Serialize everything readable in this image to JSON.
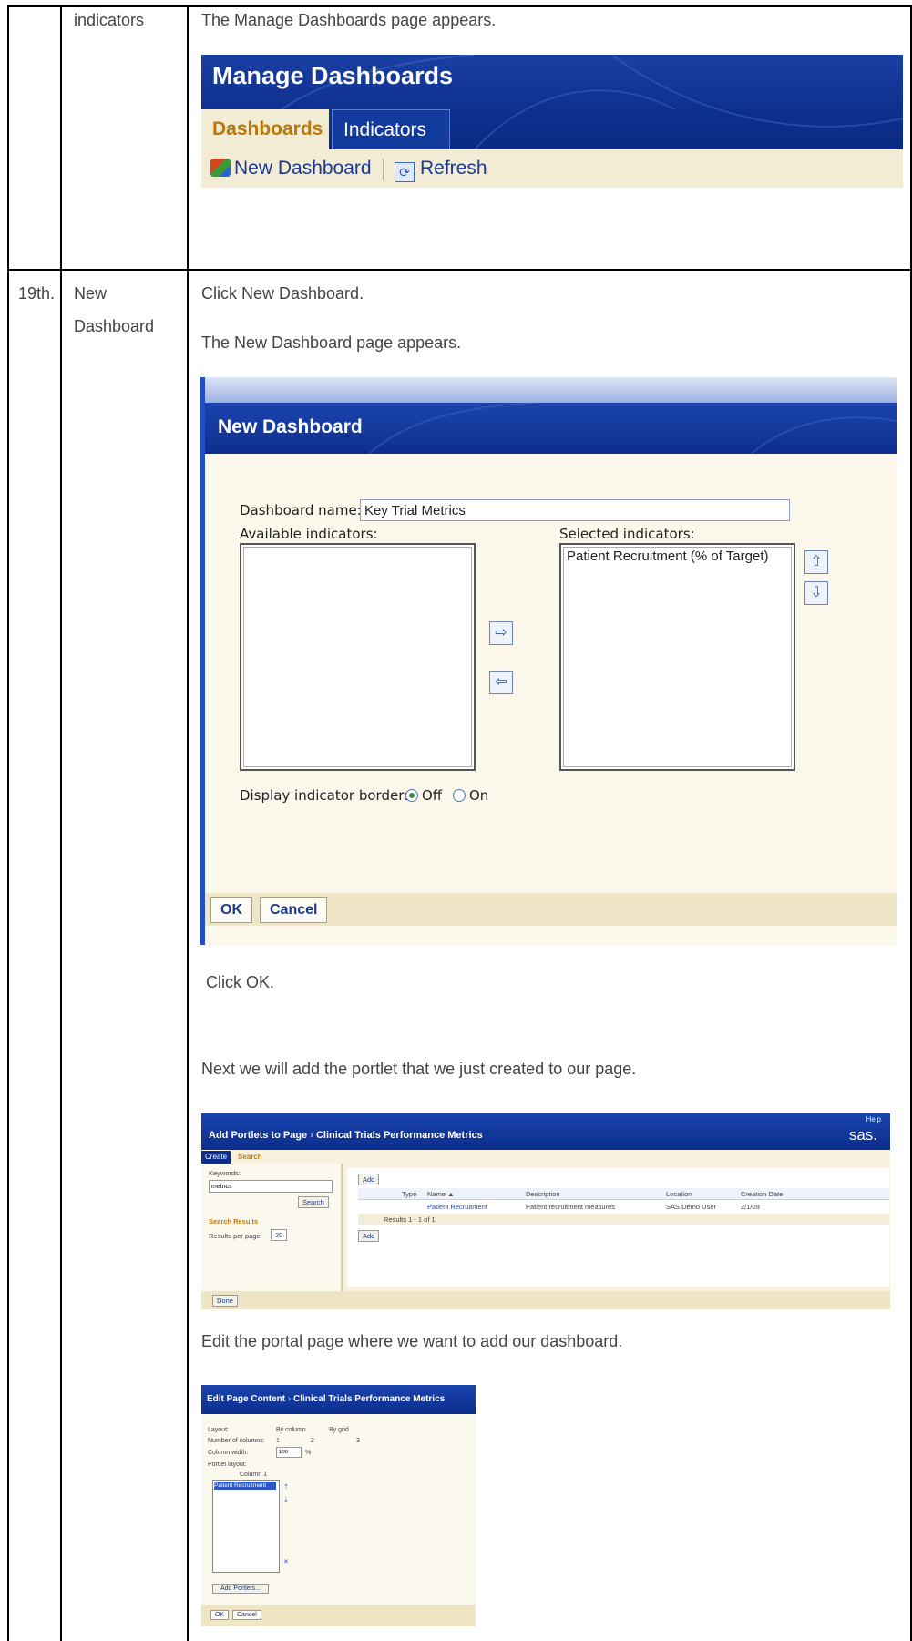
{
  "rows": {
    "row1": {
      "action": "indicators",
      "detail": "The Manage Dashboards page appears."
    },
    "row2": {
      "step": "19th.",
      "action_line1": "New",
      "action_line2": "Dashboard",
      "instructions": [
        "Click New Dashboard.",
        "The New Dashboard page appears.",
        "Click OK.",
        "Next we will add the portlet that we just created to our page.",
        "Edit the portal page where we want to add our dashboard."
      ]
    }
  },
  "manage_dashboards": {
    "title": "Manage Dashboards",
    "tabs": [
      "Dashboards",
      "Indicators"
    ],
    "toolbar": {
      "new_label": "New Dashboard",
      "refresh_label": "Refresh"
    }
  },
  "new_dashboard": {
    "title": "New Dashboard",
    "name_label": "Dashboard name:",
    "name_value": "Key Trial Metrics",
    "available_label": "Available indicators:",
    "selected_label": "Selected indicators:",
    "selected_items": [
      "Patient Recruitment (% of Target)"
    ],
    "borders_label": "Display indicator borders:",
    "borders_options": [
      "Off",
      "On"
    ],
    "borders_selected": "Off",
    "ok_label": "OK",
    "cancel_label": "Cancel"
  },
  "add_portlets": {
    "title": "Add Portlets to Page",
    "subtitle": "Clinical Trials Performance Metrics",
    "help": "Help",
    "logo": "sas.",
    "tabs": [
      "Create",
      "Search"
    ],
    "keywords_label": "Keywords:",
    "keywords_value": "metrics",
    "search_button": "Search",
    "search_results_label": "Search Results",
    "results_per_page_label": "Results per page:",
    "results_per_page_value": "20",
    "add_button": "Add",
    "columns": [
      "Type",
      "Name ▲",
      "Description",
      "Location",
      "Creation Date"
    ],
    "row": {
      "name": "Patient Recruitment",
      "description": "Patient recruitment measures",
      "location": "SAS Demo User",
      "date": "2/1/09"
    },
    "results_text": "Results 1 - 1 of 1",
    "done_button": "Done"
  },
  "edit_page": {
    "title": "Edit Page Content",
    "subtitle": "Clinical Trials Performance Metrics",
    "layout_label": "Layout:",
    "layout_options": [
      "By column",
      "By grid"
    ],
    "columns_label": "Number of columns:",
    "columns_options": [
      "1",
      "2",
      "3"
    ],
    "width_label": "Column width:",
    "width_value": "100",
    "width_unit": "%",
    "portlet_layout_label": "Portlet layout:",
    "column_header": "Column 1",
    "portlet_item": "Patient Recruitment",
    "add_portlets_button": "Add Portlets...",
    "ok_label": "OK",
    "cancel_label": "Cancel"
  }
}
